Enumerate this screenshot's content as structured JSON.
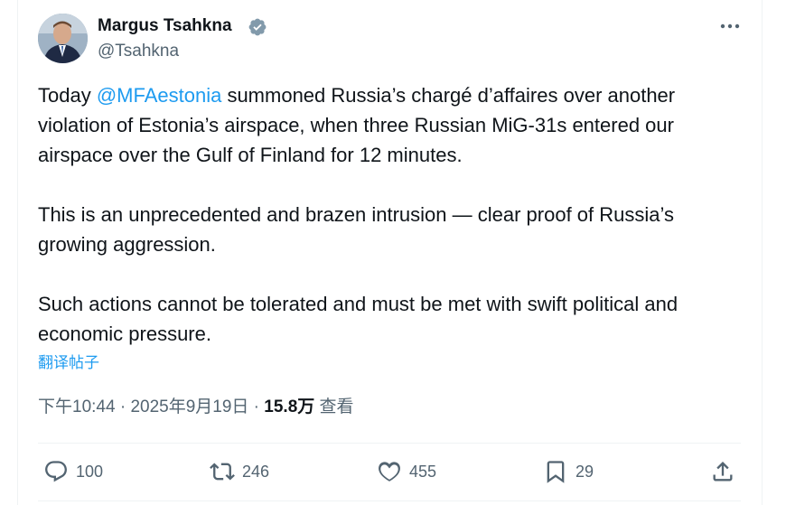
{
  "author": {
    "name": "Margus Tsahkna",
    "handle": "@Tsahkna"
  },
  "icons": {
    "verified": "verified-badge-icon",
    "more": "more-dots-icon",
    "reply": "reply-icon",
    "retweet": "retweet-icon",
    "like": "heart-icon",
    "bookmark": "bookmark-icon",
    "share": "share-icon"
  },
  "colors": {
    "accent": "#1d9bf0",
    "secondary": "#536471",
    "text": "#0f1419",
    "verified": "#829aab"
  },
  "tweet": {
    "p1_prefix": "Today ",
    "p1_mention": "@MFAestonia",
    "p1_rest": " summoned Russia’s chargé d’affaires over another violation of Estonia’s airspace, when three Russian MiG-31s entered our airspace over the Gulf of Finland for 12 minutes.",
    "p2": "This is an unprecedented and brazen intrusion — clear proof of Russia’s growing aggression.",
    "p3": "Such actions cannot be tolerated and must be met with swift political and economic pressure.",
    "translate_label": "翻译帖子"
  },
  "meta": {
    "time": "下午10:44",
    "sep1": " · ",
    "date": "2025年9月19日",
    "sep2": " · ",
    "views_count": "15.8万",
    "views_label": " 查看"
  },
  "actions": {
    "replies": "100",
    "retweets": "246",
    "likes": "455",
    "bookmarks": "29"
  }
}
